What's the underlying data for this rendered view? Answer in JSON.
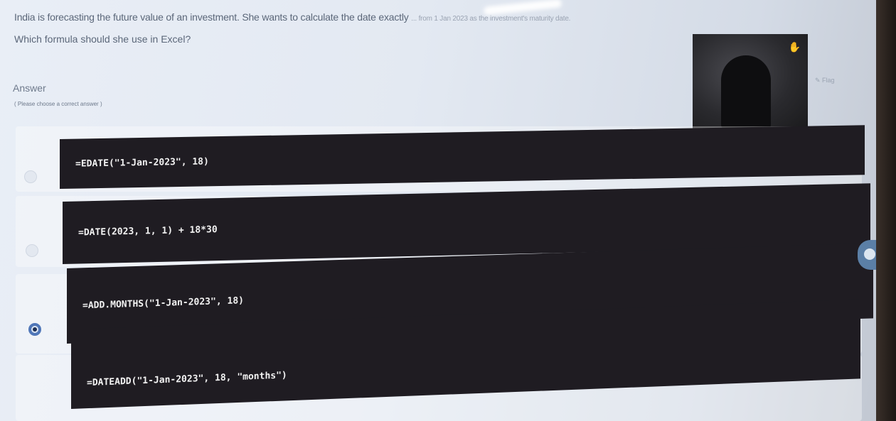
{
  "question": {
    "line1": "India is forecasting the future value of an investment. She wants to calculate the date exactly",
    "line1_faded": "... from 1 Jan 2023 as the investment's maturity date.",
    "line2": "Which formula should she use in Excel?"
  },
  "answer": {
    "label": "Answer",
    "hint": "( Please choose a correct answer )"
  },
  "options": [
    {
      "formula": "=EDATE(\"1-Jan-2023\", 18)",
      "selected": false
    },
    {
      "formula": "=DATE(2023, 1, 1) + 18*30",
      "selected": false
    },
    {
      "formula": "=ADD.MONTHS(\"1-Jan-2023\", 18)",
      "selected": true
    },
    {
      "formula": "=DATEADD(\"1-Jan-2023\", 18, \"months\")",
      "selected": false
    }
  ],
  "flag": {
    "label": "Flag"
  },
  "icons": {
    "webcam": "user-video-icon",
    "hand": "hand-icon",
    "side": "toggle-icon"
  },
  "colors": {
    "code_bg": "#1f1c22",
    "radio_selected": "#4f76b8"
  }
}
